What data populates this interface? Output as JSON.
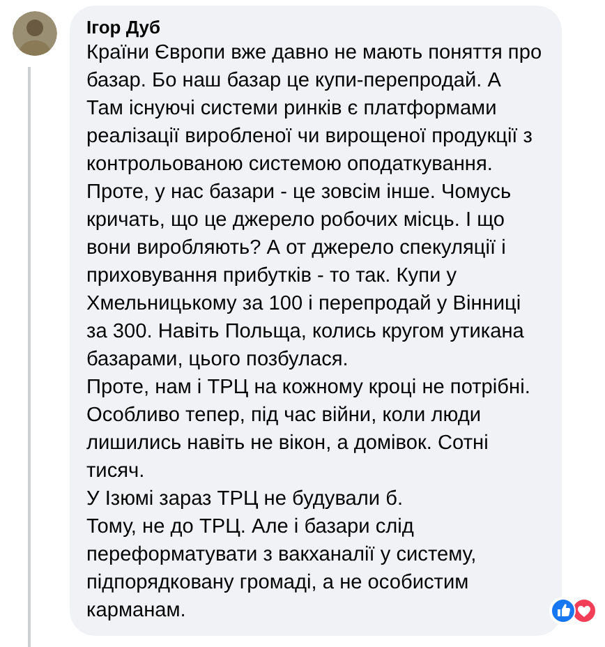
{
  "comment": {
    "author": "Ігор Дуб",
    "paragraphs": [
      "Країни Європи вже давно не мають поняття про базар. Бо наш базар це купи-перепродай. А Там існуючі системи ринків є платформами реалізації виробленої чи вирощеної продукції з контрольованою системою оподаткування.",
      "Проте, у нас базари - це зовсім інше. Чомусь кричать, що це джерело робочих місць. І що вони виробляють? А от джерело спекуляції і приховування прибутків - то так. Купи у Хмельницькому за 100 і перепродай у Вінниці за 300. Навіть Польща, колись кругом утикана базарами, цього позбулася.",
      "Проте, нам і ТРЦ на кожному кроці не потрібні.",
      "Особливо тепер, під час війни, коли люди лишились навіть не вікон, а домівок. Сотні тисяч.",
      "У Ізюмі зараз ТРЦ не будували б.",
      "Тому, не до ТРЦ. Але і базари слід переформатувати з вакханалії у систему, підпорядковану громаді, а не особистим карманам."
    ],
    "reactions": [
      {
        "kind": "like"
      },
      {
        "kind": "love"
      }
    ]
  }
}
